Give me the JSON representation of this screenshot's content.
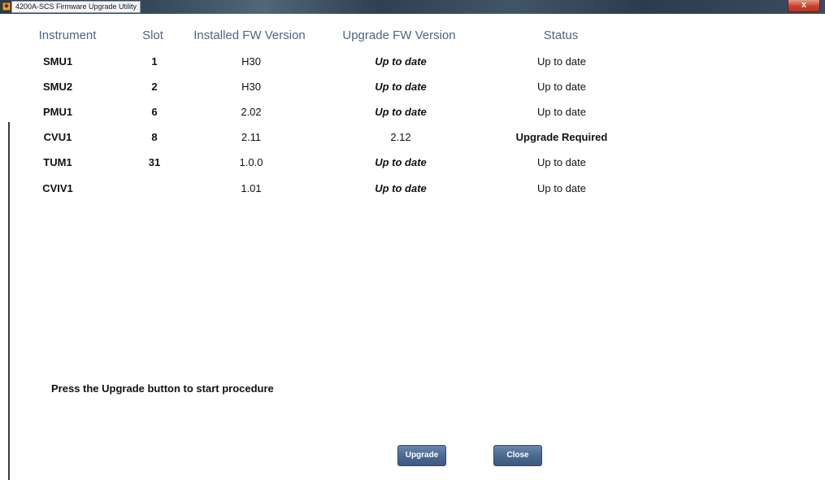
{
  "window": {
    "title": "4200A-SCS Firmware Upgrade Utility",
    "close_glyph": "x"
  },
  "table": {
    "headers": {
      "instrument": "Instrument",
      "slot": "Slot",
      "installed": "Installed FW Version",
      "upgrade": "Upgrade FW Version",
      "status": "Status"
    },
    "rows": [
      {
        "instrument": "SMU1",
        "slot": "1",
        "installed": "H30",
        "upgrade": "Up to date",
        "status": "Up to date"
      },
      {
        "instrument": "SMU2",
        "slot": "2",
        "installed": "H30",
        "upgrade": "Up to date",
        "status": "Up to date"
      },
      {
        "instrument": "PMU1",
        "slot": "6",
        "installed": "2.02",
        "upgrade": "Up to date",
        "status": "Up to date"
      },
      {
        "instrument": "CVU1",
        "slot": "8",
        "installed": "2.11",
        "upgrade": "2.12",
        "status": "Upgrade Required"
      },
      {
        "instrument": "TUM1",
        "slot": "31",
        "installed": "1.0.0",
        "upgrade": "Up to date",
        "status": "Up to date"
      },
      {
        "instrument": "CVIV1",
        "slot": "",
        "installed": "1.01",
        "upgrade": "Up to date",
        "status": "Up to date"
      }
    ]
  },
  "instruction": "Press the Upgrade button to start procedure",
  "buttons": {
    "upgrade": "Upgrade",
    "close": "Close"
  },
  "colors": {
    "header_text": "#4d6582",
    "button": "#4a6790"
  }
}
